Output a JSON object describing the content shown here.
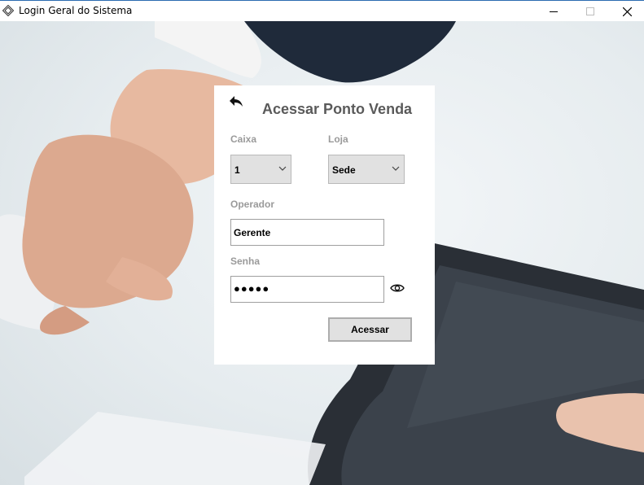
{
  "window": {
    "title": "Login Geral do Sistema",
    "app_icon": "diamond-logo-icon",
    "controls": [
      "minimize-icon",
      "maximize-icon",
      "close-icon"
    ]
  },
  "card": {
    "back_icon": "undo-arrow-icon",
    "title": "Acessar Ponto Venda",
    "caixa": {
      "label": "Caixa",
      "value": "1"
    },
    "loja": {
      "label": "Loja",
      "value": "Sede"
    },
    "operador": {
      "label": "Operador",
      "value": "Gerente"
    },
    "senha": {
      "label": "Senha",
      "value": "●●●●●",
      "reveal_icon": "eye-icon"
    },
    "submit_label": "Acessar"
  },
  "colors": {
    "title_text": "#5a5a5a",
    "label_text": "#9a9a9a",
    "control_bg": "#e1e1e1",
    "card_bg": "#ffffff"
  }
}
